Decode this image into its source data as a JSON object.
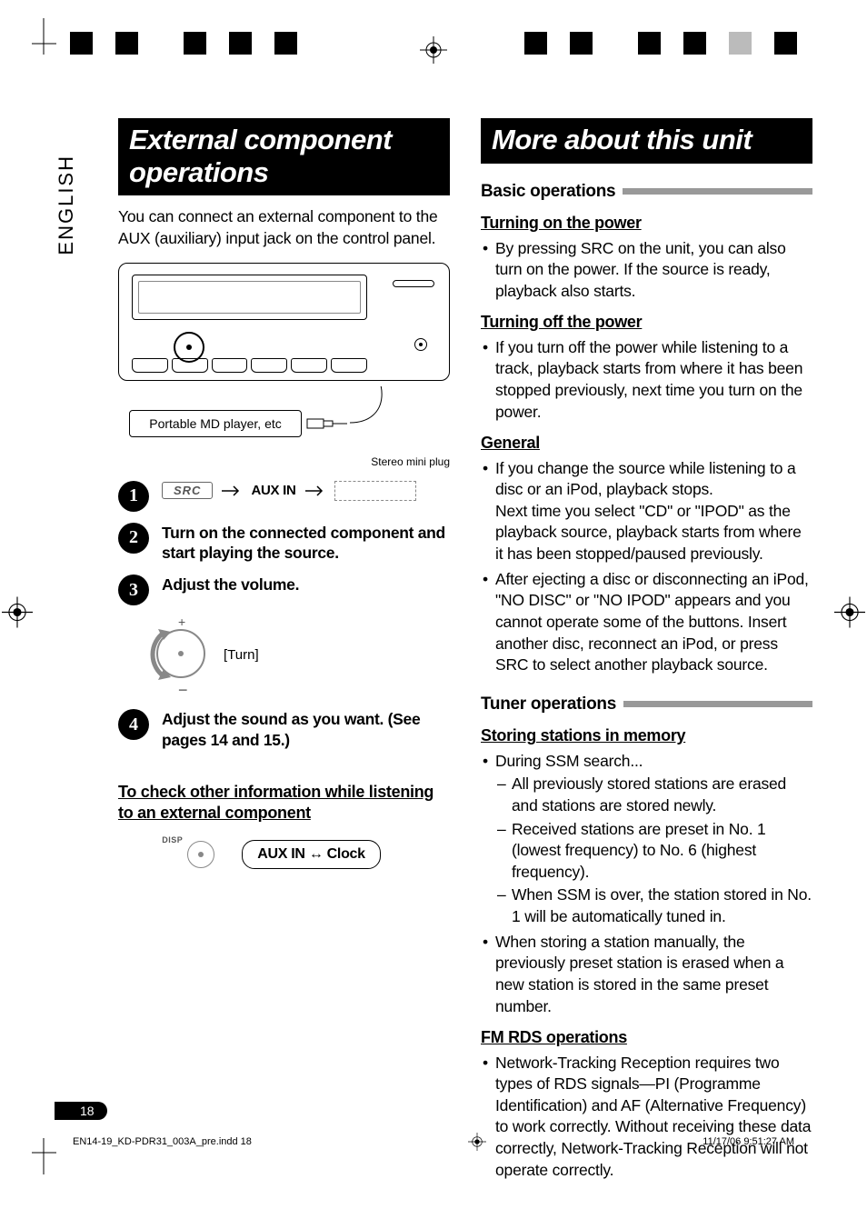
{
  "language_tab": "ENGLISH",
  "left": {
    "title": "External component operations",
    "intro": "You can connect an external component to the AUX (auxiliary) input jack on the control panel.",
    "md_label": "Portable MD player, etc",
    "mini_plug_label": "Stereo mini plug",
    "step1_aux": "AUX IN",
    "src_btn": "SRC",
    "step2": "Turn on the connected component and start playing the source.",
    "step3": "Adjust the volume.",
    "turn_label": "[Turn]",
    "step4": "Adjust the sound as you want. (See pages 14 and 15.)",
    "check_info": "To check other information while listening to an external component",
    "disp_label": "DISP",
    "clock_box": "AUX IN ↔ Clock"
  },
  "right": {
    "title": "More about this unit",
    "basic_ops": "Basic operations",
    "turn_on_h": "Turning on the power",
    "turn_on_b": "By pressing SRC on the unit, you can also turn on the power. If the source is ready, playback also starts.",
    "turn_off_h": "Turning off the power",
    "turn_off_b": "If you turn off the power while listening to a track, playback starts from where it has been stopped previously, next time you turn on the power.",
    "general_h": "General",
    "general_b1a": "If you change the source while listening to a disc or an iPod, playback stops.",
    "general_b1b": "Next time you select \"CD\" or \"IPOD\" as the playback source, playback starts from where it has been stopped/paused previously.",
    "general_b2": "After ejecting a disc or disconnecting an iPod, \"NO DISC\" or \"NO IPOD\" appears and you cannot operate some of the buttons. Insert another disc, reconnect an iPod, or press SRC to select another playback source.",
    "tuner_ops": "Tuner operations",
    "storing_h": "Storing stations in memory",
    "ssm_intro": "During SSM search...",
    "ssm_d1": "All previously stored stations are erased and stations are stored newly.",
    "ssm_d2": "Received stations are preset in No. 1 (lowest frequency) to No. 6 (highest frequency).",
    "ssm_d3": "When SSM is over, the station stored in No. 1 will be automatically tuned in.",
    "manual_b": "When storing a station manually, the previously preset station is erased when a new station is stored in the same preset number.",
    "rds_h": "FM RDS operations",
    "rds_b": "Network-Tracking Reception requires two types of RDS signals—PI (Programme Identification) and AF (Alternative Frequency) to work correctly. Without receiving these data correctly, Network-Tracking Reception will not operate correctly."
  },
  "page_number": "18",
  "footer": {
    "file": "EN14-19_KD-PDR31_003A_pre.indd   18",
    "timestamp": "11/17/06   9:51:27 AM"
  }
}
